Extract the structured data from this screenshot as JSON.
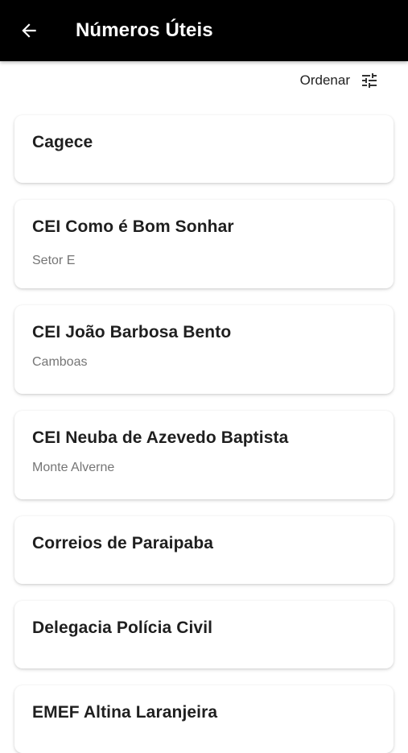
{
  "appbar": {
    "back_icon": "arrow-left-icon",
    "title": "Números Úteis"
  },
  "sort": {
    "label": "Ordenar",
    "icon": "sliders-icon"
  },
  "contacts": [
    {
      "name": "Cagece",
      "subtitle": ""
    },
    {
      "name": "CEI Como é Bom Sonhar",
      "subtitle": "Setor E"
    },
    {
      "name": "CEI João Barbosa Bento",
      "subtitle": "Camboas"
    },
    {
      "name": "CEI Neuba de Azevedo Baptista",
      "subtitle": "Monte Alverne"
    },
    {
      "name": "Correios de Paraipaba",
      "subtitle": ""
    },
    {
      "name": "Delegacia Polícia Civil",
      "subtitle": ""
    },
    {
      "name": "EMEF Altina Laranjeira",
      "subtitle": ""
    }
  ]
}
